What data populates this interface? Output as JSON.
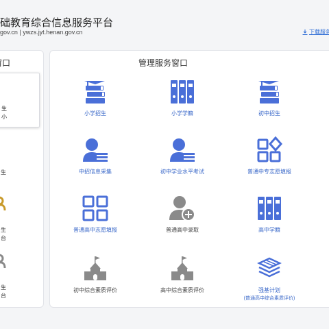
{
  "header": {
    "title": "础教育综合信息服务平台",
    "urls": "gov.cn | ywzs.jyt.henan.gov.cn",
    "download_label": "下载服务"
  },
  "left_panel": {
    "title": "窗口",
    "items": [
      {
        "line1": "生",
        "line2": "小"
      },
      {
        "line1": "生",
        "line2": "台"
      },
      {
        "line1": "生",
        "line2": "台"
      }
    ]
  },
  "main_panel": {
    "title": "管理服务窗口",
    "tiles": [
      {
        "label": "小学招生",
        "icon": "books-cap-icon"
      },
      {
        "label": "小学学籍",
        "icon": "binders-icon"
      },
      {
        "label": "初中招生",
        "icon": "books-cap-icon"
      },
      {
        "label": "中招信息采集",
        "icon": "user-list-icon"
      },
      {
        "label": "初中学业水平考试",
        "icon": "user-list-icon"
      },
      {
        "label": "普通中专志愿填报",
        "icon": "grid-diamond-icon"
      },
      {
        "label": "普通高中志愿填报",
        "icon": "grid-icon"
      },
      {
        "label": "普通高中录取",
        "icon": "user-add-icon"
      },
      {
        "label": "高中学籍",
        "icon": "binders-icon"
      },
      {
        "label": "初中综合素质评价",
        "icon": "school-icon"
      },
      {
        "label": "高中综合素质评价",
        "icon": "school-icon"
      },
      {
        "label": "强基计划",
        "sublabel": "(普通高中综合素质评价)",
        "icon": "layers-icon"
      }
    ]
  },
  "colors": {
    "accent": "#4a6fd8",
    "gray_icon": "#8a8a8a",
    "gold_icon": "#c89a2a"
  }
}
